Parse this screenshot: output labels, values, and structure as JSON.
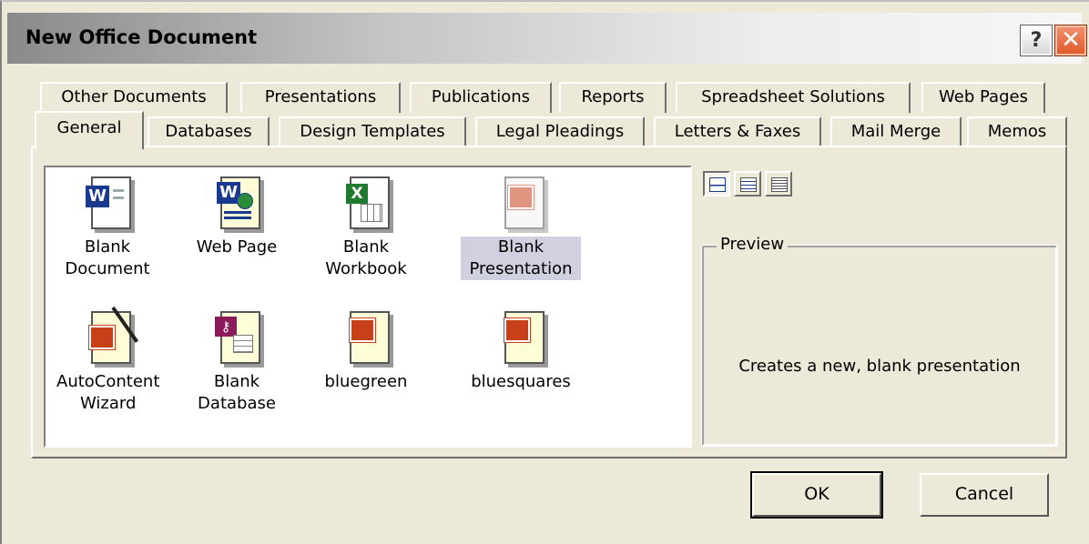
{
  "dialog": {
    "title": "New Office Document",
    "help_label": "?",
    "close_label": "✕"
  },
  "tabs": {
    "back_row": [
      "Other Documents",
      "Presentations",
      "Publications",
      "Reports",
      "Spreadsheet Solutions",
      "Web Pages"
    ],
    "front_row": [
      "General",
      "Databases",
      "Design Templates",
      "Legal Pleadings",
      "Letters & Faxes",
      "Mail Merge",
      "Memos"
    ],
    "active": "General"
  },
  "templates": [
    {
      "label": "Blank Document",
      "icon": "word-document-icon",
      "selected": false
    },
    {
      "label": "Web Page",
      "icon": "word-web-page-icon",
      "selected": false
    },
    {
      "label": "Blank Workbook",
      "icon": "excel-workbook-icon",
      "selected": false
    },
    {
      "label": "Blank Presentation",
      "icon": "powerpoint-presentation-icon",
      "selected": true
    },
    {
      "label": "AutoContent Wizard",
      "icon": "autocontent-wizard-icon",
      "selected": false
    },
    {
      "label": "Blank Database",
      "icon": "access-database-icon",
      "selected": false
    },
    {
      "label": "bluegreen",
      "icon": "powerpoint-template-icon",
      "selected": false
    },
    {
      "label": "bluesquares",
      "icon": "powerpoint-template-icon",
      "selected": false
    }
  ],
  "view_buttons": [
    "large-icons-view-icon",
    "list-view-icon",
    "details-view-icon"
  ],
  "preview": {
    "legend": "Preview",
    "text": "Creates a new, blank presentation"
  },
  "buttons": {
    "ok": "OK",
    "cancel": "Cancel"
  },
  "colors": {
    "word": "#1a3a8f",
    "excel": "#1e7a2e",
    "powerpoint": "#c8401a",
    "access": "#8a1a5a",
    "selection": "#d0d0e0"
  }
}
